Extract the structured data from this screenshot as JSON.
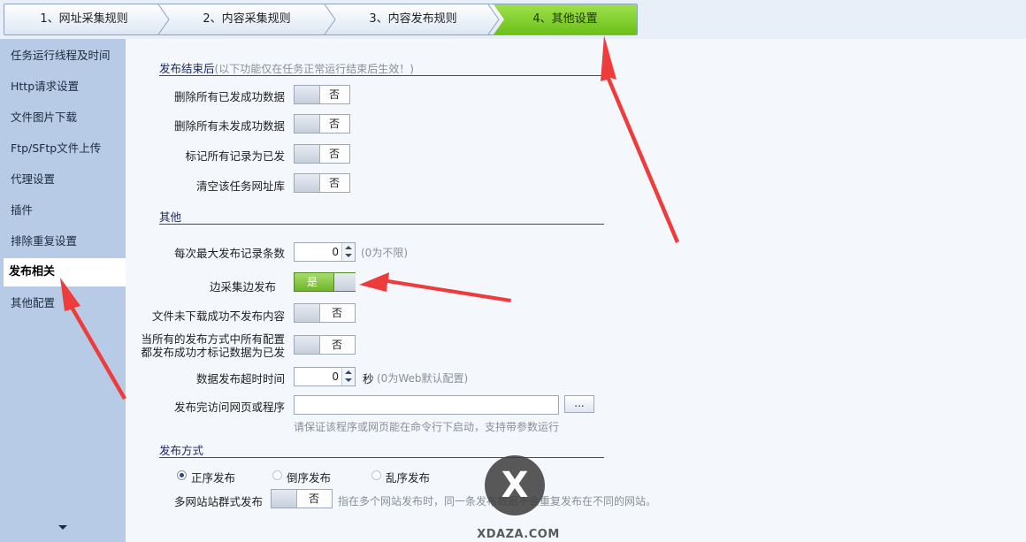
{
  "steps": [
    "1、网址采集规则",
    "2、内容采集规则",
    "3、内容发布规则",
    "4、其他设置"
  ],
  "nav": {
    "items": [
      "任务运行线程及时间",
      "Http请求设置",
      "文件图片下载",
      "Ftp/SFtp文件上传",
      "代理设置",
      "插件",
      "排除重复设置",
      "发布相关",
      "其他配置"
    ],
    "active_index": 7
  },
  "after_publish": {
    "title": "发布结束后",
    "note": "(以下功能仅在任务正常运行结束后生效！)",
    "rows": [
      {
        "label": "删除所有已发成功数据",
        "value": "否"
      },
      {
        "label": "删除所有未发成功数据",
        "value": "否"
      },
      {
        "label": "标记所有记录为已发",
        "value": "否"
      },
      {
        "label": "清空该任务网址库",
        "value": "否"
      }
    ]
  },
  "other": {
    "title": "其他",
    "max_records": {
      "label": "每次最大发布记录条数",
      "value": "0",
      "hint": "(0为不限)"
    },
    "collect_publish": {
      "label": "边采集边发布",
      "value": "是"
    },
    "file_fail": {
      "label": "文件未下载成功不发布内容",
      "value": "否"
    },
    "all_success": {
      "label_line1": "当所有的发布方式中所有配置",
      "label_line2": "都发布成功才标记数据为已发",
      "value": "否"
    },
    "timeout": {
      "label": "数据发布超时时间",
      "value": "0",
      "unit": "秒",
      "hint": "(0为Web默认配置)"
    },
    "visit_after": {
      "label": "发布完访问网页或程序",
      "value": "",
      "button": "...",
      "hint": "请保证该程序或网页能在命令行下启动，支持带参数运行"
    }
  },
  "publish_mode": {
    "title": "发布方式",
    "options": [
      "正序发布",
      "倒序发布",
      "乱序发布"
    ],
    "selected": "正序发布",
    "multi_site": {
      "label": "多网站站群式发布",
      "value": "否",
      "hint": "指在多个网站发布时，同一条发布数据不会重复发布在不同的网站。"
    }
  },
  "watermark": {
    "glyph": "X",
    "text": "XDAZA.COM"
  },
  "colors": {
    "accent_green": "#7cc828",
    "arrow_red": "#ee3b3b",
    "section_blue": "#1a2a6a"
  }
}
